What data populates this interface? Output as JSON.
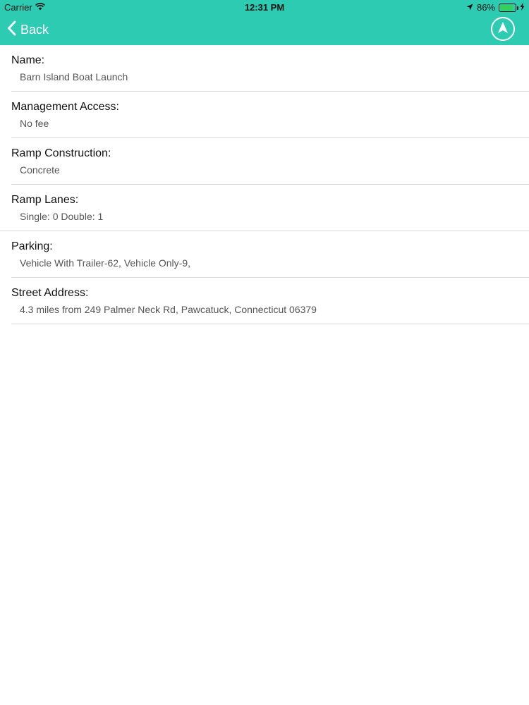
{
  "status_bar": {
    "carrier": "Carrier",
    "time": "12:31 PM",
    "battery_percent": "86%",
    "battery_level": 0.86
  },
  "nav_bar": {
    "back_label": "Back",
    "background_color": "#2ecbb3"
  },
  "details": [
    {
      "label": "Name:",
      "value": "Barn Island Boat Launch"
    },
    {
      "label": "Management Access:",
      "value": "No fee"
    },
    {
      "label": "Ramp Construction:",
      "value": "Concrete"
    },
    {
      "label": "Ramp Lanes:",
      "value": "Single: 0 Double: 1"
    },
    {
      "label": "Parking:",
      "value": "Vehicle With Trailer-62, Vehicle Only-9,"
    },
    {
      "label": "Street Address:",
      "value": "4.3 miles from 249 Palmer Neck Rd, Pawcatuck, Connecticut 06379"
    }
  ]
}
